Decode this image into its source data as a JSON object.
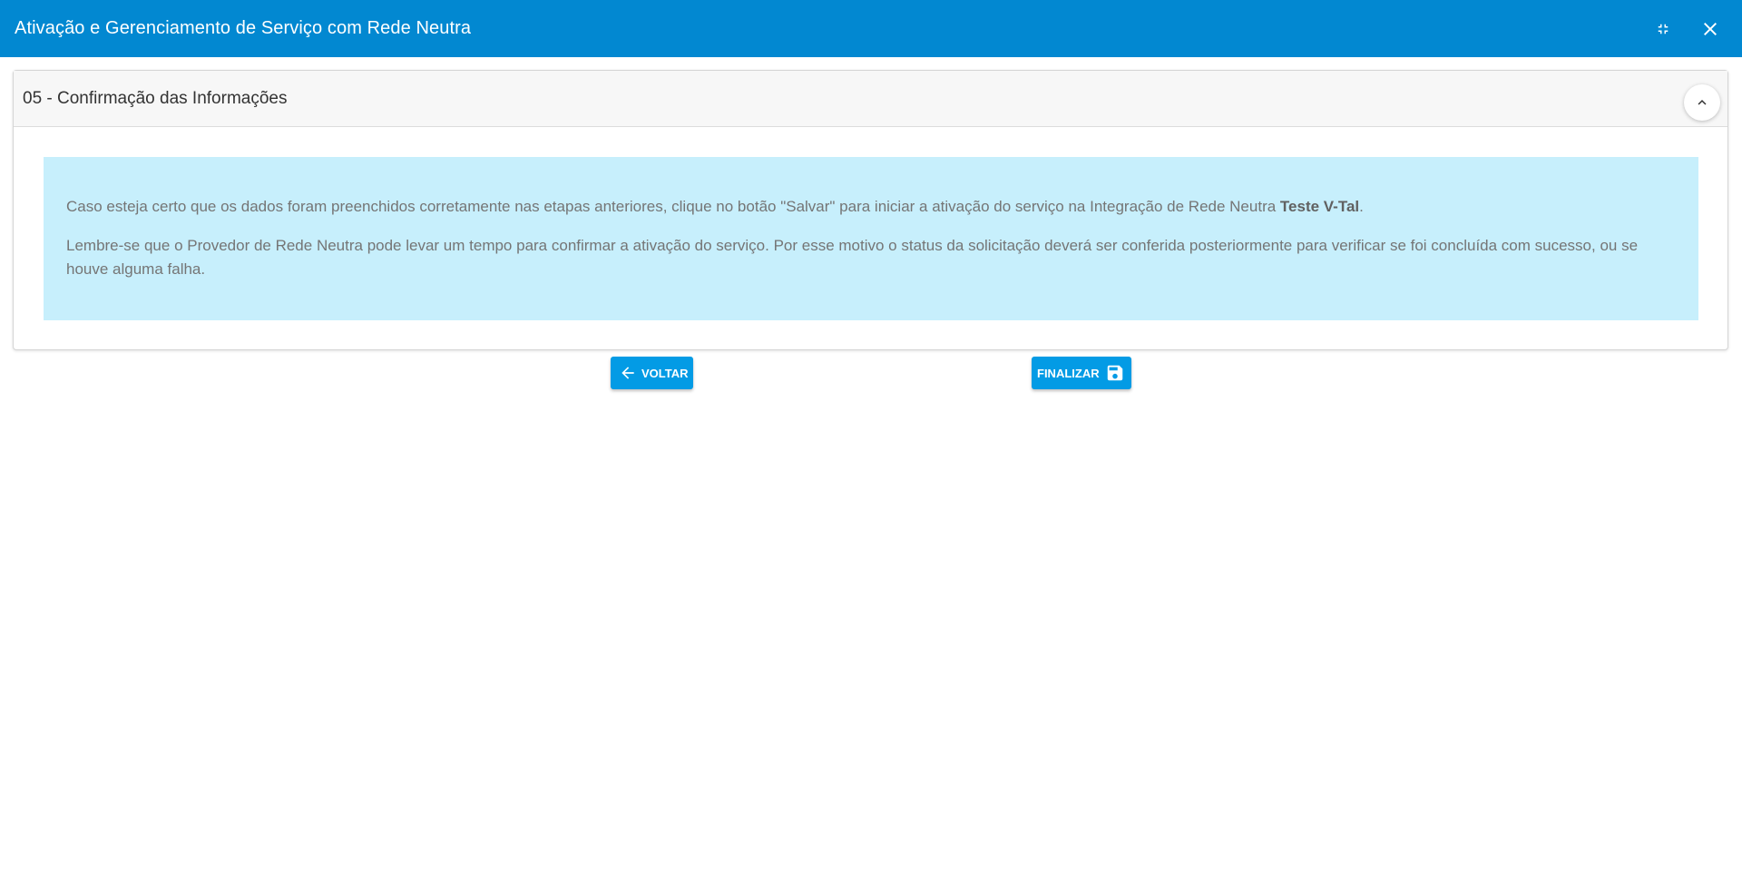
{
  "window": {
    "title": "Ativação e Gerenciamento de Serviço com Rede Neutra",
    "icons": {
      "minimize": "compress-icon",
      "close": "close-icon"
    },
    "colors": {
      "titlebar": "#0288d1",
      "button": "#039be5",
      "info_background": "#c7effc"
    }
  },
  "panel": {
    "title": "05 - Confirmação das Informações",
    "collapse_icon": "chevron-up-icon",
    "info": {
      "line1_prefix": "Caso esteja certo que os dados foram preenchidos corretamente nas etapas anteriores, clique no botão \"Salvar\" para iniciar a ativação do serviço na Integração de Rede Neutra ",
      "line1_bold": "Teste V-Tal",
      "line1_suffix": ".",
      "line2": "Lembre-se que o Provedor de Rede Neutra pode levar um tempo para confirmar a ativação do serviço. Por esse motivo o status da solicitação deverá ser conferida posteriormente para verificar se foi concluída com sucesso, ou se houve alguma falha."
    }
  },
  "buttons": {
    "back_label": "VOLTAR",
    "back_icon": "arrow-left-icon",
    "finish_label": "FINALIZAR",
    "finish_icon": "save-icon"
  }
}
